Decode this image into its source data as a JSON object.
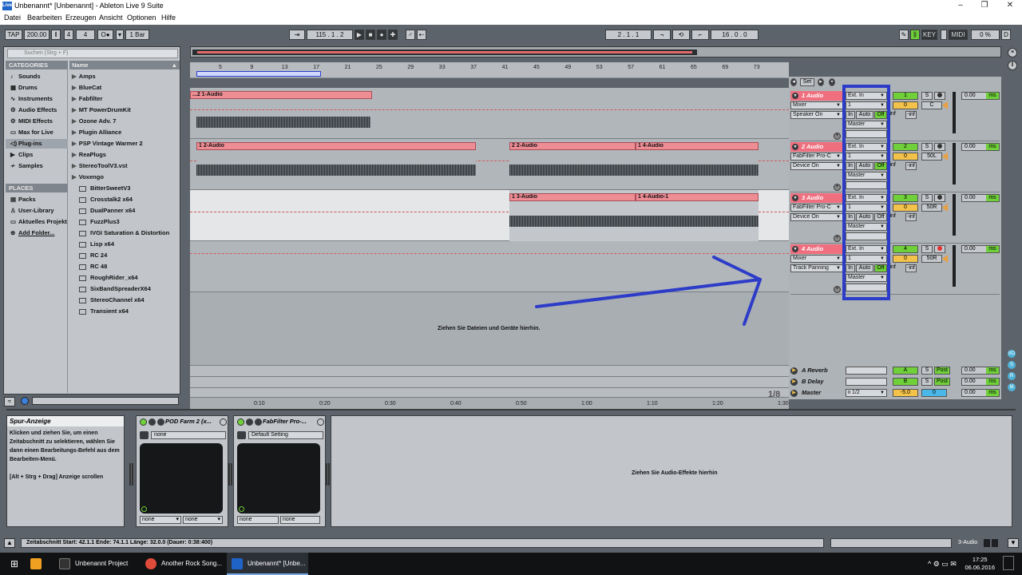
{
  "window": {
    "title": "Unbenannt* [Unbenannt] - Ableton Live 9 Suite",
    "app_icon_text": "Live",
    "minimize": "–",
    "maximize": "❐",
    "close": "✕"
  },
  "menu": [
    "Datei",
    "Bearbeiten",
    "Erzeugen",
    "Ansicht",
    "Optionen",
    "Hilfe"
  ],
  "control_bar": {
    "tap": "TAP",
    "tempo": "200.00",
    "signature_num": "4",
    "signature_den": "4",
    "metronome": "O●",
    "quantize": "1 Bar",
    "arrangement_position": "115 .   1 .   2",
    "loop_start": "2 .   1 .   1",
    "loop_length": "16 .   0 .   0",
    "key": "KEY",
    "midi": "MIDI",
    "cpu": "0 %",
    "d": "D"
  },
  "browser": {
    "search_placeholder": "Suchen (Strg + F)",
    "categories_header": "CATEGORIES",
    "categories": [
      {
        "label": "Sounds",
        "icon": "♪"
      },
      {
        "label": "Drums",
        "icon": "▦"
      },
      {
        "label": "Instruments",
        "icon": "∿"
      },
      {
        "label": "Audio Effects",
        "icon": "⚙"
      },
      {
        "label": "MIDI Effects",
        "icon": "⚙"
      },
      {
        "label": "Max for Live",
        "icon": "▭"
      },
      {
        "label": "Plug-ins",
        "icon": "◁)"
      },
      {
        "label": "Clips",
        "icon": "▶"
      },
      {
        "label": "Samples",
        "icon": "≁"
      }
    ],
    "places_header": "PLACES",
    "places": [
      {
        "label": "Packs",
        "icon": "▤"
      },
      {
        "label": "User-Library",
        "icon": "♙"
      },
      {
        "label": "Aktuelles Projekt",
        "icon": "▭"
      },
      {
        "label": "Add Folder...",
        "icon": "⊕"
      }
    ],
    "name_header": "Name",
    "folders": [
      "Amps",
      "BlueCat",
      "Fabfilter",
      "MT PowerDrumKit",
      "Ozone Adv. 7",
      "Plugin Alliance",
      "PSP Vintage Warmer 2",
      "ReaPlugs",
      "StereoToolV3.vst",
      "Voxengo"
    ],
    "plugins": [
      "BitterSweetV3",
      "Crosstalk2 x64",
      "DualPanner x64",
      "FuzzPlus3",
      "IVGI Saturation & Distortion",
      "Lisp x64",
      "RC 24",
      "RC 48",
      "RoughRider_x64",
      "SixBandSpreaderX64",
      "StereoChannel x64",
      "Transient x64"
    ]
  },
  "ruler": {
    "bars": [
      "5",
      "9",
      "13",
      "17",
      "21",
      "25",
      "29",
      "33",
      "37",
      "41",
      "45",
      "49",
      "53",
      "57",
      "61",
      "65",
      "69",
      "73"
    ],
    "times": [
      "0:10",
      "0:20",
      "0:30",
      "0:40",
      "0:50",
      "1:00",
      "1:10",
      "1:20",
      "1:30"
    ],
    "zoom": "1/8"
  },
  "clips": {
    "t1": [
      "...2 1-Audio"
    ],
    "t2": [
      "1 2-Audio",
      "2 2-Audio",
      "1 4-Audio"
    ],
    "t3": [
      "1 3-Audio",
      "1 4-Audio-1"
    ]
  },
  "drop_hint": "Ziehen Sie Dateien und Geräte hierhin.",
  "mixer": {
    "set_label": "Set",
    "tracks": [
      {
        "name": "1 Audio",
        "chooser": "Mixer",
        "param": "Speaker On",
        "input": "Ext. In",
        "channel": "1",
        "monitor": [
          "In",
          "Auto",
          "Off"
        ],
        "output": "Master",
        "number": "1",
        "vol": "0",
        "pan": "C",
        "inf1": "-inf",
        "inf2": "-inf",
        "delay": "0.00",
        "ms": "ms"
      },
      {
        "name": "2 Audio",
        "chooser": "FabFilter Pro-C",
        "param": "Device On",
        "input": "Ext. In",
        "channel": "1",
        "monitor": [
          "In",
          "Auto",
          "Off"
        ],
        "output": "Master",
        "number": "2",
        "vol": "0",
        "pan": "50L",
        "inf1": "-inf",
        "inf2": "-inf",
        "delay": "0.00",
        "ms": "ms"
      },
      {
        "name": "3 Audio",
        "chooser": "FabFilter Pro-C",
        "param": "Device On",
        "input": "Ext. In",
        "channel": "1",
        "monitor": [
          "In",
          "Auto",
          "Off"
        ],
        "output": "Master",
        "number": "3",
        "vol": "0",
        "pan": "50R",
        "inf1": "-inf",
        "inf2": "-inf",
        "delay": "0.00",
        "ms": "ms"
      },
      {
        "name": "4 Audio",
        "chooser": "Mixer",
        "param": "Track Panning",
        "input": "Ext. In",
        "channel": "1",
        "monitor": [
          "In",
          "Auto",
          "Off"
        ],
        "output": "Master",
        "number": "4",
        "vol": "0",
        "pan": "50R",
        "inf1": "-inf",
        "inf2": "-inf",
        "delay": "0.00",
        "ms": "ms"
      }
    ],
    "returns": [
      {
        "name": "A Reverb",
        "letter": "A",
        "solo": "S",
        "post": "Post",
        "delay": "0.00",
        "ms": "ms"
      },
      {
        "name": "B Delay",
        "letter": "B",
        "solo": "S",
        "post": "Post",
        "delay": "0.00",
        "ms": "ms"
      },
      {
        "name": "Master",
        "cue": "ii 1/2",
        "vol": "-5.0",
        "pan": "0",
        "delay": "0.00",
        "ms": "ms"
      }
    ],
    "solo": "S"
  },
  "info_view": {
    "title": "Spur-Anzeige",
    "body": "Klicken und ziehen Sie, um einen Zeitabschnitt zu selektieren, wählen Sie dann einen Bearbeitungs-Befehl aus dem Bearbeiten-Menü.",
    "body2": "[Alt + Strg + Drag] Anzeige scrollen"
  },
  "devices": [
    {
      "name": "POD Farm 2 (x...",
      "preset": "none",
      "sel1": "none",
      "sel2": "none"
    },
    {
      "name": "FabFilter Pro-...",
      "preset": "Default Setting",
      "sel1": "none",
      "sel2": "none"
    }
  ],
  "fx_drop_hint": "Ziehen Sie Audio-Effekte hierhin",
  "status": {
    "text": "Zeitabschnitt   Start: 42.1.1    Ende: 74.1.1    Länge: 32.0.0  (Dauer: 0:38:400)",
    "right": "3-Audio"
  },
  "taskbar": {
    "items": [
      "Unbenannt Project",
      "Another Rock Song...",
      "Unbenannt* [Unbe..."
    ],
    "time": "17:25",
    "date": "06.06.2016"
  },
  "colors": {
    "clip": "#ef8d95",
    "track_header": "#ef6f7f",
    "annotation": "#2d3cc8",
    "green": "#6fd03a"
  }
}
